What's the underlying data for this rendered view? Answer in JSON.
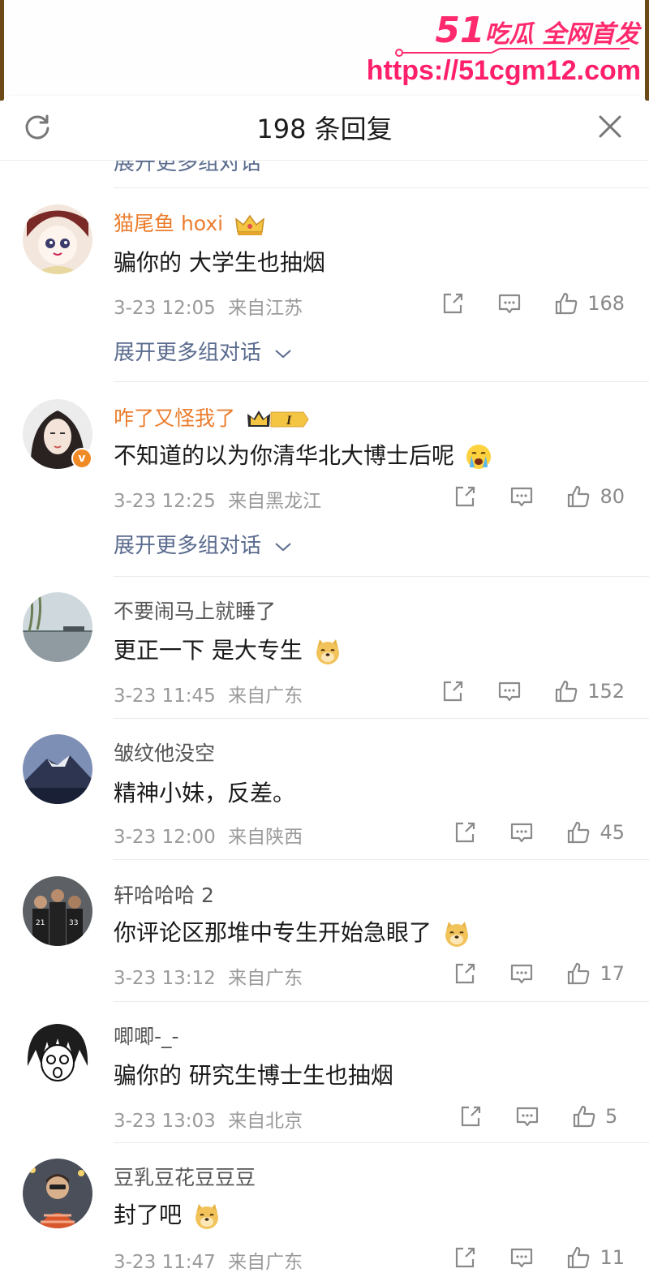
{
  "watermark": {
    "brand_number": "51",
    "brand_text": "吃瓜 全网首发",
    "url": "https://51cgm12.com"
  },
  "header": {
    "title": "198 条回复"
  },
  "peek_text": "展开更多组对话",
  "comments": [
    {
      "username": "猫尾鱼 hoxi",
      "text": "骗你的 大学生也抽烟",
      "time": "3-23 12:05",
      "location": "来自江苏",
      "likes": "168",
      "expand": "展开更多组对话"
    },
    {
      "username": "咋了又怪我了",
      "badge_level": "I",
      "text": "不知道的以为你清华北大博士后呢",
      "time": "3-23 12:25",
      "location": "来自黑龙江",
      "likes": "80",
      "expand": "展开更多组对话"
    },
    {
      "username": "不要闹马上就睡了",
      "text": "更正一下 是大专生",
      "time": "3-23 11:45",
      "location": "来自广东",
      "likes": "152"
    },
    {
      "username": "皱纹他没空",
      "text": "精神小妹，反差。",
      "time": "3-23 12:00",
      "location": "来自陕西",
      "likes": "45"
    },
    {
      "username": "轩哈哈哈 2",
      "text": "你评论区那堆中专生开始急眼了",
      "time": "3-23 13:12",
      "location": "来自广东",
      "likes": "17"
    },
    {
      "username": "唧唧-_-",
      "text": "骗你的 研究生博士生也抽烟",
      "time": "3-23 13:03",
      "location": "来自北京",
      "likes": "5"
    },
    {
      "username": "豆乳豆花豆豆豆",
      "text": "封了吧",
      "time": "3-23 11:47",
      "location": "来自广东",
      "likes": "11"
    }
  ],
  "icons": {
    "refresh": "refresh-icon",
    "close": "close-icon",
    "share": "share-icon",
    "comment": "comment-icon",
    "like": "thumbs-up-icon",
    "chevron": "chevron-down-icon"
  },
  "colors": {
    "vip_name": "#eb7d2d",
    "link_blue": "#5a6b8e",
    "watermark_pink": "#ff2a6d",
    "meta_gray": "#9a9a9a"
  }
}
